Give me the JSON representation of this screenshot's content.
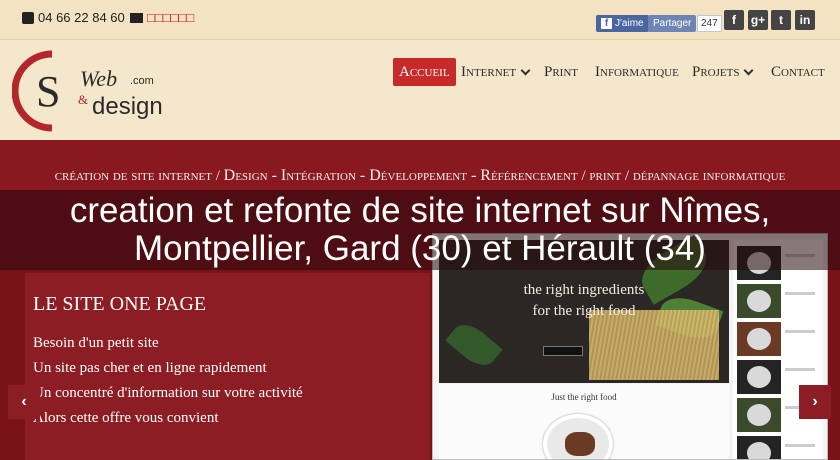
{
  "topbar": {
    "phone": "04 66 22 84 60",
    "email_glyphs": "□□□□□□",
    "facebook_like": "J'aime",
    "share": "Partager",
    "share_count": "247",
    "social_icons": [
      "facebook-icon",
      "google-plus-icon",
      "twitter-icon",
      "linkedin-icon"
    ]
  },
  "logo": {
    "c": "C",
    "s": "S",
    "web": "Web",
    "amp": "&",
    "design": "design",
    "com": ".com"
  },
  "nav": {
    "items": [
      {
        "label": "Accueil",
        "active": true,
        "dropdown": false
      },
      {
        "label": "Internet",
        "active": false,
        "dropdown": true
      },
      {
        "label": "Print",
        "active": false,
        "dropdown": false
      },
      {
        "label": "Informatique",
        "active": false,
        "dropdown": false
      },
      {
        "label": "Projets",
        "active": false,
        "dropdown": true
      },
      {
        "label": "Contact",
        "active": false,
        "dropdown": false
      }
    ]
  },
  "hero": {
    "tagline_a": "création de site internet / ",
    "tagline_b": "Design - Intégration - Développement - Référencement",
    "tagline_c": " / print / dépannage informatique",
    "title_line1": "creation et refonte de site internet sur Nîmes,",
    "title_line2": "Montpellier, Gard (30) et Hérault (34)"
  },
  "slide": {
    "heading": "LE SITE ONE PAGE",
    "lines": [
      "Besoin d'un petit site",
      "Un site pas cher et en ligne rapidement",
      "Un concentré d'information sur votre activité",
      "Alors cette offre vous convient"
    ]
  },
  "mockup": {
    "hero_line1": "the right ingredients",
    "hero_line2": "for the right food",
    "sub_title": "Just the right food"
  },
  "colors": {
    "accent": "#c62a2a",
    "hero": "#7a1219",
    "panel": "#8c1d24",
    "cream": "#f4e7cb"
  }
}
